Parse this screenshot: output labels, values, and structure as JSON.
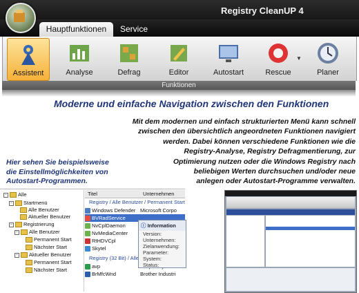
{
  "app": {
    "title": "Registry CleanUP 4"
  },
  "tabs": [
    {
      "label": "Hauptfunktionen",
      "active": true
    },
    {
      "label": "Service",
      "active": false
    }
  ],
  "ribbon": {
    "buttons": [
      {
        "label": "Assistent",
        "icon": "wizard-icon",
        "active": true
      },
      {
        "label": "Analyse",
        "icon": "analyse-icon"
      },
      {
        "label": "Defrag",
        "icon": "defrag-icon"
      },
      {
        "label": "Editor",
        "icon": "editor-icon"
      },
      {
        "label": "Autostart",
        "icon": "autostart-icon"
      },
      {
        "label": "Rescue",
        "icon": "rescue-icon"
      },
      {
        "label": "Planer",
        "icon": "planer-icon"
      }
    ],
    "group_label": "Funktionen"
  },
  "headline": "Moderne und einfache Navigation zwischen den Funktionen",
  "description": [
    "Mit dem modernen und einfach strukturierten Menü kann schnell",
    "zwischen den übersichtlich angeordneten Funktionen navigiert",
    "werden. Dabei können verschiedene Funktionen wie die",
    "Registry-Analyse, Registry Defragmentierung, zur",
    "Optimierung nutzen oder die Windows Registry nach",
    "beliebigen Werten durchsuchen und/oder neue",
    "anlegen oder Autostart-Programme verwalten."
  ],
  "caption": [
    "Hier sehen Sie beispielsweise",
    "die Einstellmöglichkeiten von",
    "Autostart-Programmen."
  ],
  "tree": [
    "Alle",
    "Startmenü",
    "Alle Benutzer",
    "Aktueller Benutzer",
    "Registrierung",
    "Alle Benutzer",
    "Permanent Start",
    "Nächster Start",
    "Aktueller Benutzer",
    "Permanent Start",
    "Nächster Start"
  ],
  "list": {
    "headers": [
      "Titel",
      "Unternehmen"
    ],
    "group1": "Registry / Alle Benutzer / Permanent Start",
    "rows": [
      {
        "title": "Windows Defender",
        "company": "Microsoft Corpo"
      },
      {
        "title": "BVRadService",
        "company": ""
      },
      {
        "title": "NvCplDaemon",
        "company": ""
      },
      {
        "title": "NvMediaCenter",
        "company": ""
      },
      {
        "title": "RtHDVCpl",
        "company": ""
      },
      {
        "title": "Skytel",
        "company": ""
      }
    ],
    "group2": "Registry (32 Bit) / Alle",
    "rows2": [
      {
        "title": "avp",
        "company": "Kaspersky Lab"
      },
      {
        "title": "BrMfcWnd",
        "company": "Brother Industri"
      }
    ]
  },
  "popup": {
    "title": "Information",
    "fields": [
      "Version:",
      "Unternehmen:",
      "Zielanwendung:",
      "Parameter:",
      "System:",
      "Status:"
    ]
  }
}
